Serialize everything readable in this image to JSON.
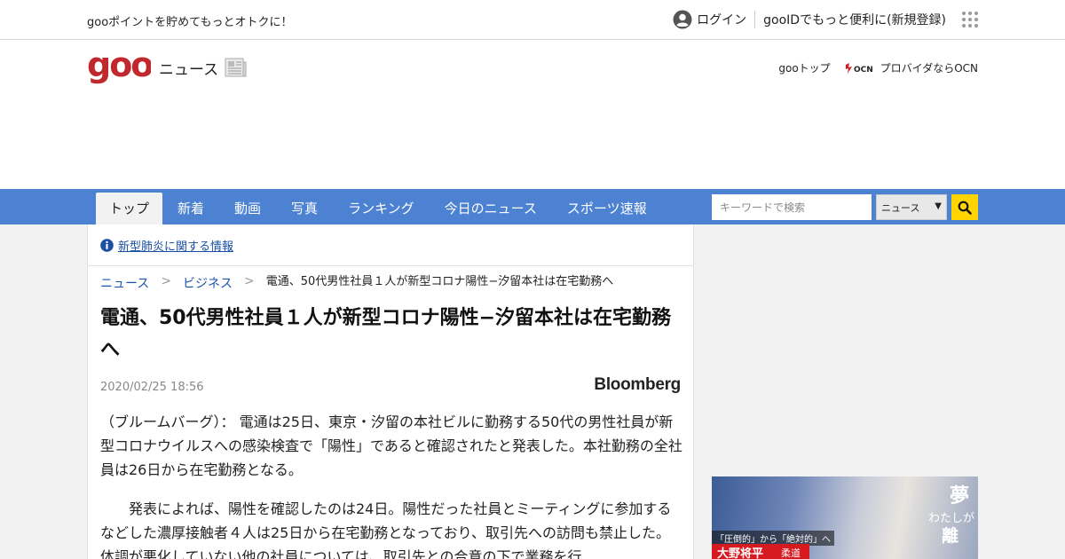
{
  "utility_bar": {
    "promo": "gooポイントを貯めてもっとオトクに！",
    "login_label": "ログイン",
    "register_label": "gooIDでもっと便利に(新規登録)"
  },
  "header": {
    "logo_text": "goo",
    "section_label": "ニュース",
    "goo_top_link": "gooトップ",
    "ocn_logo_text": "OCN",
    "ocn_link": "プロバイダならOCN"
  },
  "nav": {
    "tabs": [
      {
        "label": "トップ",
        "active": true
      },
      {
        "label": "新着"
      },
      {
        "label": "動画"
      },
      {
        "label": "写真"
      },
      {
        "label": "ランキング"
      },
      {
        "label": "今日のニュース"
      },
      {
        "label": "スポーツ速報"
      }
    ],
    "search_placeholder": "キーワードで検索",
    "search_scope": "ニュース"
  },
  "notice": {
    "link": "新型肺炎に関する情報"
  },
  "breadcrumb": {
    "items": [
      "ニュース",
      "ビジネス"
    ],
    "current": "電通、50代男性社員１人が新型コロナ陽性−汐留本社は在宅勤務へ"
  },
  "article": {
    "title": "電通、50代男性社員１人が新型コロナ陽性−汐留本社は在宅勤務へ",
    "date": "2020/02/25 18:56",
    "source": "Bloomberg",
    "paragraphs": [
      "（ブルームバーグ）： 電通は25日、東京・汐留の本社ビルに勤務する50代の男性社員が新型コロナウイルスへの感染検査で「陽性」であると確認されたと発表した。本社勤務の全社員は26日から在宅勤務となる。",
      "発表によれば、陽性を確認したのは24日。陽性だった社員とミーティングに参加するなどした濃厚接触者４人は25日から在宅勤務となっており、取引先への訪問も禁止した。体調が悪化していない他の社員については、取引先との合意の下で業務を行"
    ]
  },
  "ad": {
    "headline_1": "夢",
    "headline_2": "わたしが",
    "headline_3": "離",
    "catch": "「圧倒的」から「絶対的」へ",
    "name": "大野将平",
    "sport": "柔道"
  },
  "colors": {
    "nav_bg": "#4d82d3",
    "search_button": "#ffd400",
    "logo_red": "#c0282d",
    "link_blue": "#1a55b0"
  }
}
